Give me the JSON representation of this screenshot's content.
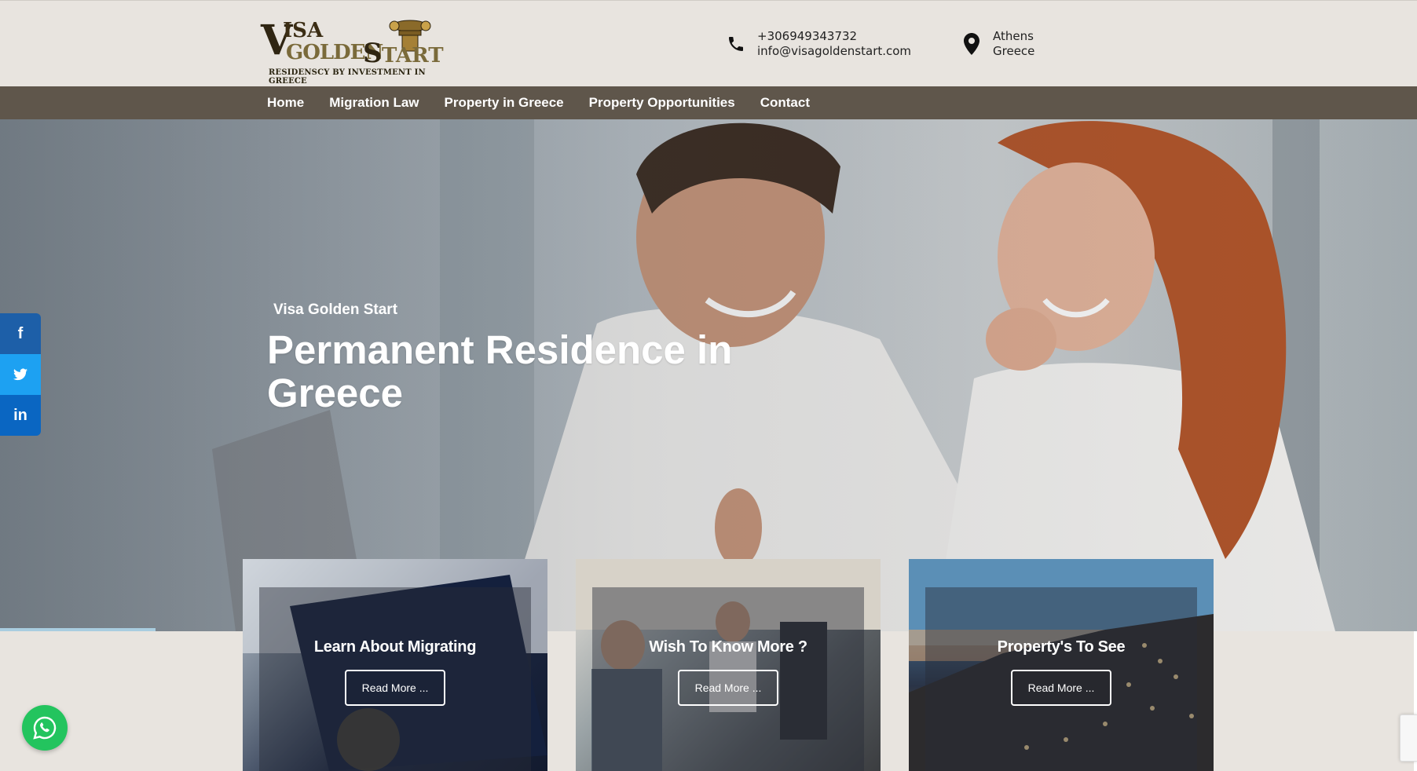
{
  "header": {
    "logo": {
      "main": "VISA GOLDENSTART",
      "tagline": "RESIDENSCY BY INVESTMENT IN GREECE"
    },
    "phone": "+306949343732",
    "email": "info@visagoldenstart.com",
    "location_line1": "Athens",
    "location_line2": "Greece"
  },
  "nav": {
    "items": [
      "Home",
      "Migration Law",
      "Property in Greece",
      "Property Opportunities",
      "Contact"
    ]
  },
  "hero": {
    "kicker": "Visa Golden Start",
    "title": "Permanent Residence in Greece"
  },
  "social": {
    "facebook": "f",
    "twitter": "twitter-icon",
    "linkedin": "in"
  },
  "cards": [
    {
      "title": "Learn About Migrating",
      "button": "Read More ..."
    },
    {
      "title": "Wish To Know More ?",
      "button": "Read More ..."
    },
    {
      "title": "Property's To See",
      "button": "Read More ..."
    }
  ],
  "colors": {
    "nav_bg": "#5f564b",
    "page_bg": "#e8e4df",
    "whatsapp": "#23c45e",
    "facebook": "#1d5fa8",
    "twitter": "#1da1f2",
    "linkedin": "#0a66c2"
  },
  "icons": {
    "phone": "phone-icon",
    "location": "map-pin-icon",
    "whatsapp": "whatsapp-icon"
  }
}
